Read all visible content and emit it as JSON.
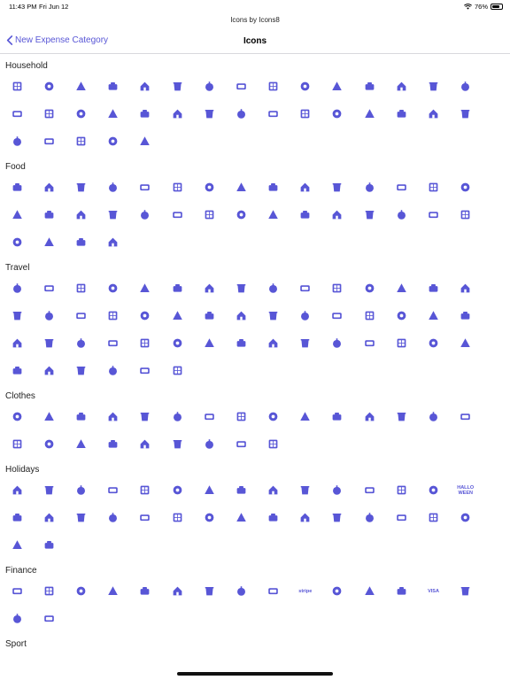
{
  "status_bar": {
    "time": "11:43 PM",
    "date": "Fri Jun 12",
    "battery": "76%",
    "battery_level": 0.76
  },
  "app_title": "Icons by Icons8",
  "nav": {
    "back_label": "New Expense Category",
    "title": "Icons"
  },
  "accent_color": "#5856d6",
  "sections": [
    {
      "title": "Household",
      "icons": [
        "window-icon",
        "bathtub-icon",
        "blender-icon",
        "tea-cup-icon",
        "tv-icon",
        "faucet-icon",
        "bed-icon",
        "shower-icon",
        "flower-pot-icon",
        "stairs-icon",
        "frying-pan-icon",
        "armchair-icon",
        "vase-icon",
        "air-conditioner-icon",
        "trash-can-icon",
        "fireplace-icon",
        "lightbulb-icon",
        "sofa-icon",
        "office-chair-icon",
        "glass-icon",
        "monitor-icon",
        "house-icon",
        "safe-icon",
        "cleaning-person-icon",
        "ceiling-lamp-icon",
        "garage-icon",
        "rug-icon",
        "house-price-icon",
        "bath-icon",
        "spatula-icon",
        "broom-icon",
        "speaker-icon",
        "fridge-icon",
        "building-icon",
        "car-icon"
      ]
    },
    {
      "title": "Food",
      "icons": [
        "kebab-icon",
        "pepper-icon",
        "apple-icon",
        "jam-jar-icon",
        "coconut-icon",
        "grapes-icon",
        "pot-icon",
        "watermelon-icon",
        "shrimp-icon",
        "strawberry-icon",
        "champagne-icon",
        "pig-icon",
        "cookie-icon",
        "hamburger-icon",
        "steak-icon",
        "baguette-icon",
        "beans-icon",
        "popsicle-icon",
        "chocolate-icon",
        "soda-icon",
        "honey-icon",
        "pizza-icon",
        "basket-icon",
        "roast-chicken-icon",
        "cherries-icon",
        "pancakes-icon",
        "mushroom-icon",
        "dice-icon",
        "turnip-icon",
        "ham-icon",
        "salad-bowl-icon",
        "cheese-icon",
        "crab-icon",
        "cupcake-icon"
      ]
    },
    {
      "title": "Travel",
      "icons": [
        "passport-icon",
        "helicopter-icon",
        "mug-icon",
        "hut-icon",
        "swimming-pool-icon",
        "cruise-ship-icon",
        "palm-island-icon",
        "paw-icon",
        "taxi-icon",
        "ticket-icon",
        "beach-umbrella-icon",
        "museum-icon",
        "beach-ball-icon",
        "luggage-cart-icon",
        "pet-icon",
        "camping-icon",
        "ski-icon",
        "city-icon",
        "landing-icon",
        "visa-card-icon",
        "eiffel-tower-icon",
        "no-entry-icon",
        "car-front-icon",
        "sedan-icon",
        "snorkel-icon",
        "hotel-icon",
        "cocktails-icon",
        "bus-icon",
        "ship-icon",
        "tower-of-pisa-icon",
        "capitol-icon",
        "beach-chair-icon",
        "camper-icon",
        "mountains-icon",
        "police-hat-icon",
        "fishing-rod-icon",
        "airplane-icon",
        "train-tickets-icon",
        "island-icon",
        "amphora-icon",
        "desert-icon",
        "footprints-icon",
        "departure-icon",
        "campfire-icon",
        "tram-icon",
        "train-icon",
        "sunscreen-icon",
        "flip-flops-icon",
        "tent-icon",
        "hot-air-balloon-icon",
        "boarding-pass-icon"
      ]
    },
    {
      "title": "Clothes",
      "icons": [
        "tie-icon",
        "dress-icon",
        "sock-icon",
        "jacket-icon",
        "bow-tie-icon",
        "hat-icon",
        "bikini-icon",
        "sweater-icon",
        "ring-icon",
        "bowler-hat-icon",
        "t-shirt-icon",
        "washing-icon",
        "handbag-icon",
        "iron-icon",
        "boot-icon",
        "necktie-icon",
        "jeans-pocket-icon",
        "skates-icon",
        "beanie-icon",
        "watch-icon",
        "shirt-icon",
        "belt-icon",
        "coat-icon",
        "heels-icon"
      ]
    },
    {
      "title": "Holidays",
      "icons": [
        "advent-calendar-icon",
        "candy-cane-icon",
        "santa-icon",
        "bat-icon",
        "easter-egg-icon",
        "bell-icon",
        "starfish-icon",
        "spider-web-icon",
        "target-icon",
        "penguin-icon",
        "christmas-ball-icon",
        "gift-icon",
        "family-icon",
        "skull-icon",
        "halloween-icon",
        "cake-icon",
        "diamond-ring-icon",
        "banknote-frame-icon",
        "gingerbread-icon",
        "turkey-icon",
        "elf-icon",
        "bible-icon",
        "hot-cocoa-icon",
        "child-face-icon",
        "lollipop-icon",
        "elf-face-icon",
        "ice-skate-icon",
        "lucky-clover-icon",
        "wreath-icon",
        "candle-icon",
        "dessert-icon",
        "bunny-icon"
      ],
      "text_icons": {
        "14": "HALLO WEEN"
      }
    },
    {
      "title": "Finance",
      "icons": [
        "paypal-icon",
        "western-union-icon",
        "bitcoin-icon",
        "cash-register-icon",
        "money-hand-icon",
        "coins-icon",
        "banknote-icon",
        "piggy-icon",
        "mobile-payment-icon",
        "stripe-icon",
        "salary-icon",
        "money-delivery-icon",
        "mastercard-icon",
        "visa-icon",
        "money-bag-icon",
        "dollar-coin-icon",
        "bank-icon"
      ],
      "text_icons": {
        "9": "stripe",
        "13": "VISA"
      }
    },
    {
      "title": "Sport",
      "icons": []
    }
  ]
}
